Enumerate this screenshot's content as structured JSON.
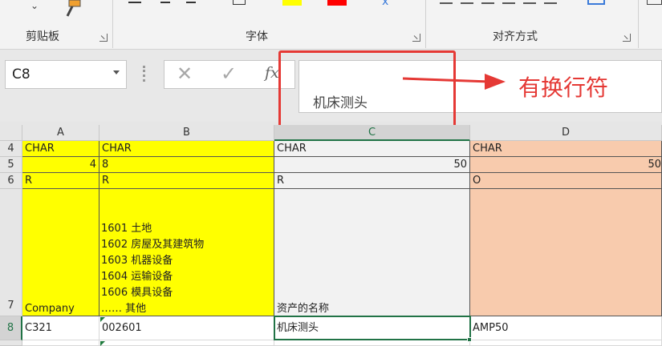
{
  "ribbon": {
    "groups": [
      {
        "label": "剪贴板"
      },
      {
        "label": "字体"
      },
      {
        "label": "对齐方式"
      }
    ]
  },
  "formula_bar": {
    "name_box": "C8",
    "fx": "fx",
    "content": "机床测头"
  },
  "annotation": {
    "text": "有换行符",
    "color": "#e53935"
  },
  "grid": {
    "columns": [
      "A",
      "B",
      "C",
      "D"
    ],
    "rows": [
      "4",
      "5",
      "6",
      "7",
      "8"
    ],
    "cells": {
      "A4": "CHAR",
      "B4": "CHAR",
      "C4": "CHAR",
      "D4": "CHAR",
      "A5": "4",
      "B5": "8",
      "C5": "50",
      "D5": "50",
      "A6": "R",
      "B6": "R",
      "C6": "R",
      "D6": "O",
      "A7": "Company",
      "B7": [
        "1601  土地",
        "1602  房屋及其建筑物",
        "1603  机器设备",
        "1604  运输设备",
        "1606  模具设备",
        "……    其他"
      ],
      "C7": "资产的名称",
      "A8": "C321",
      "B8": "002601",
      "C8": "机床测头",
      "D8": "AMP50"
    },
    "selected_cell": "C8"
  },
  "colors": {
    "yellow_fill": "#ffff00",
    "gray_fill": "#f2f2f2",
    "peach_fill": "#f8cbad",
    "excel_green": "#217346"
  }
}
